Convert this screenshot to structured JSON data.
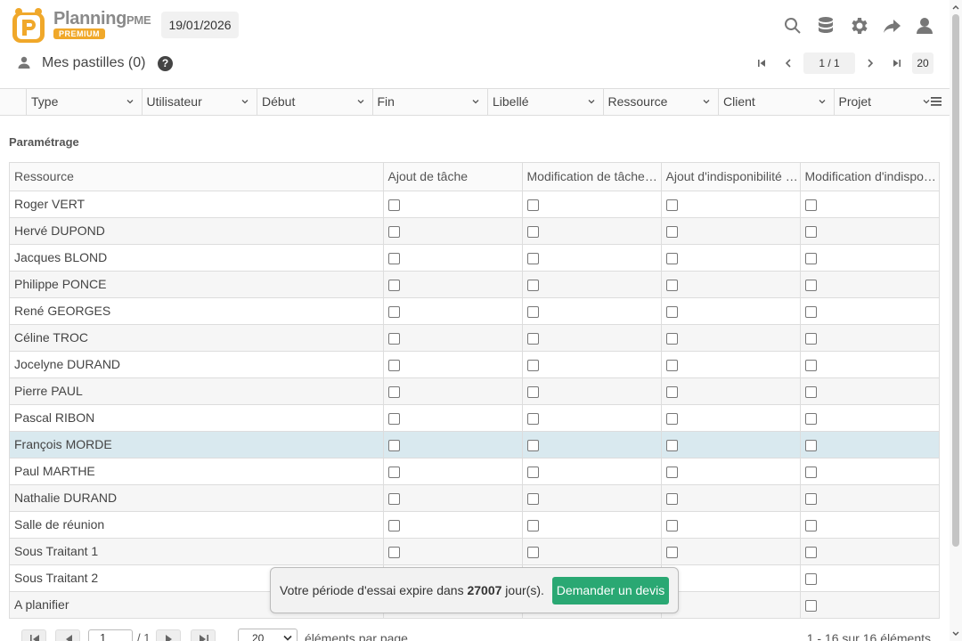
{
  "header": {
    "brand_name": "Planning",
    "brand_suffix": "PME",
    "brand_badge": "PREMIUM",
    "date": "19/01/2026",
    "icons": [
      "search-icon",
      "database-icon",
      "gear-icon",
      "share-icon",
      "user-icon"
    ]
  },
  "subheader": {
    "title": "Mes pastilles (0)",
    "help": "?",
    "pager": {
      "page": "1 / 1",
      "page_size": "20"
    }
  },
  "filters": [
    "Type",
    "Utilisateur",
    "Début",
    "Fin",
    "Libellé",
    "Ressource",
    "Client",
    "Projet"
  ],
  "section": {
    "title": "Paramétrage"
  },
  "table": {
    "columns": [
      "Ressource",
      "Ajout de tâche",
      "Modification de tâche (Début / Fin)",
      "Ajout d'indisponibilité (Absence)",
      "Modification d'indisponibilité"
    ],
    "rows": [
      "Roger VERT",
      "Hervé DUPOND",
      "Jacques BLOND",
      "Philippe PONCE",
      "René GEORGES",
      "Céline TROC",
      "Jocelyne DURAND",
      "Pierre PAUL",
      "Pascal RIBON",
      "François MORDE",
      "Paul MARTHE",
      "Nathalie DURAND",
      "Salle de réunion",
      "Sous Traitant 1",
      "Sous Traitant 2",
      "A planifier"
    ],
    "selected_row": 9
  },
  "footer": {
    "page": "1",
    "total_pages": "/ 1",
    "page_size": "20",
    "page_size_label": "éléments par page",
    "range": "1 - 16 sur 16 éléments"
  },
  "toast": {
    "prefix": "Votre période d'essai expire dans ",
    "days": "27007",
    "suffix": " jour(s).",
    "button": "Demander un devis"
  },
  "colors": {
    "accent_green": "#2aa873",
    "badge_orange": "#f0a82a",
    "selected_row": "#d9e9ef"
  }
}
